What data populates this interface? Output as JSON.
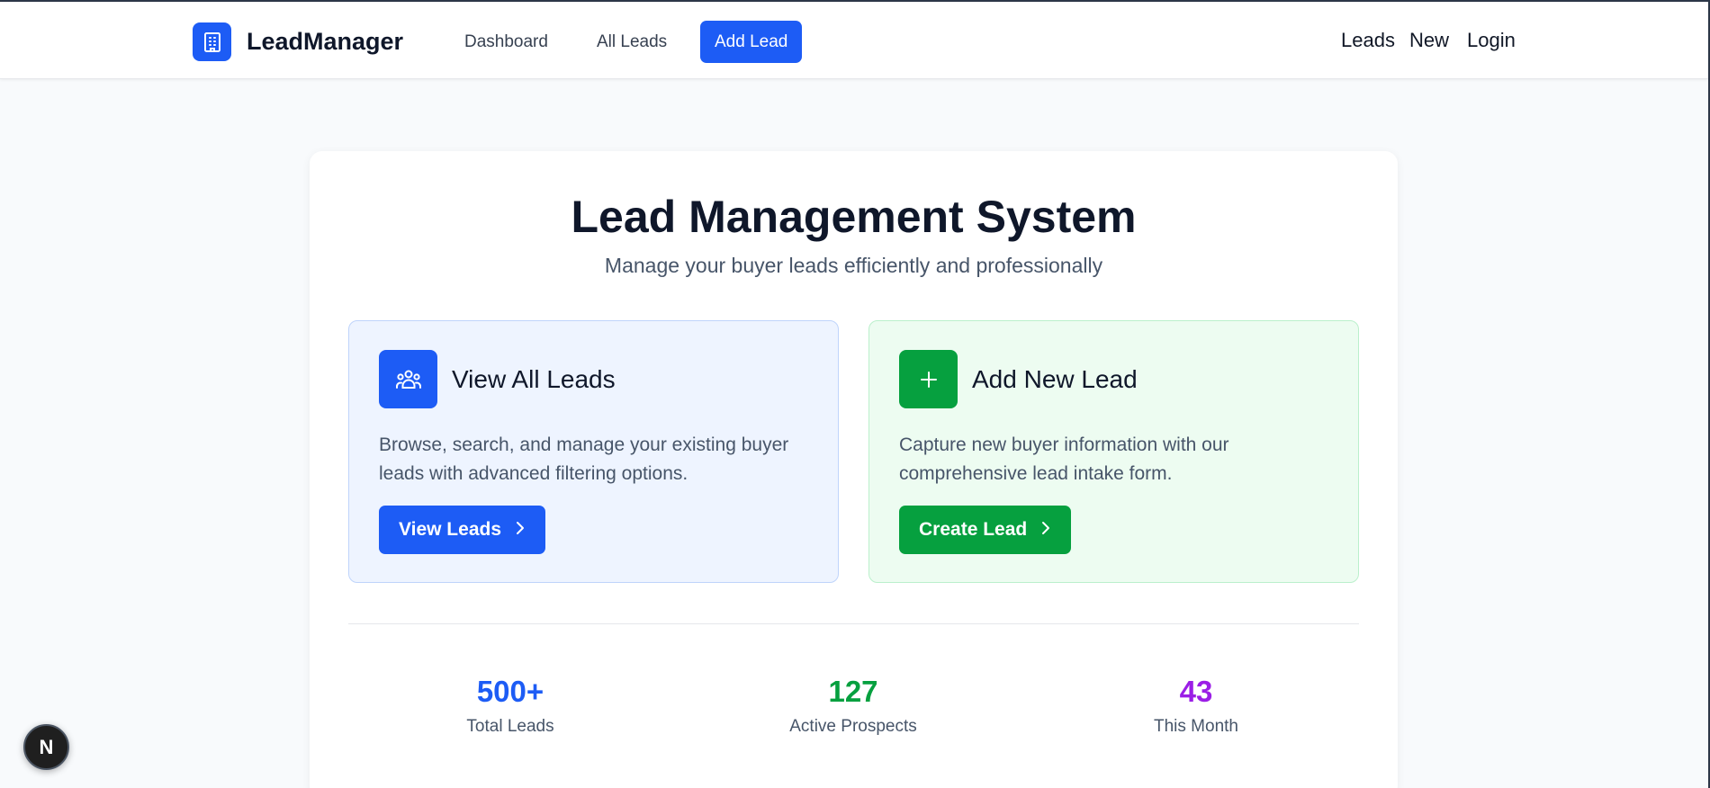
{
  "brand": {
    "name": "LeadManager",
    "logo_icon": "building-icon"
  },
  "nav": {
    "links": [
      {
        "label": "Dashboard",
        "active": false
      },
      {
        "label": "All Leads",
        "active": false
      },
      {
        "label": "Add Lead",
        "active": true
      }
    ],
    "right_links": [
      "Leads",
      "New",
      "Login"
    ]
  },
  "hero": {
    "title": "Lead Management System",
    "subtitle": "Manage your buyer leads efficiently and professionally"
  },
  "features": [
    {
      "icon": "users-icon",
      "title": "View All Leads",
      "description": "Browse, search, and manage your existing buyer leads with advanced filtering options.",
      "button": "View Leads",
      "color": "#1d5cf5"
    },
    {
      "icon": "plus-icon",
      "title": "Add New Lead",
      "description": "Capture new buyer information with our comprehensive lead intake form.",
      "button": "Create Lead",
      "color": "#06a03f"
    }
  ],
  "stats": [
    {
      "value": "500+",
      "label": "Total Leads",
      "color": "#1d5cf5"
    },
    {
      "value": "127",
      "label": "Active Prospects",
      "color": "#06a03f"
    },
    {
      "value": "43",
      "label": "This Month",
      "color": "#9b1ee6"
    }
  ],
  "dev_badge": {
    "label": "N"
  }
}
